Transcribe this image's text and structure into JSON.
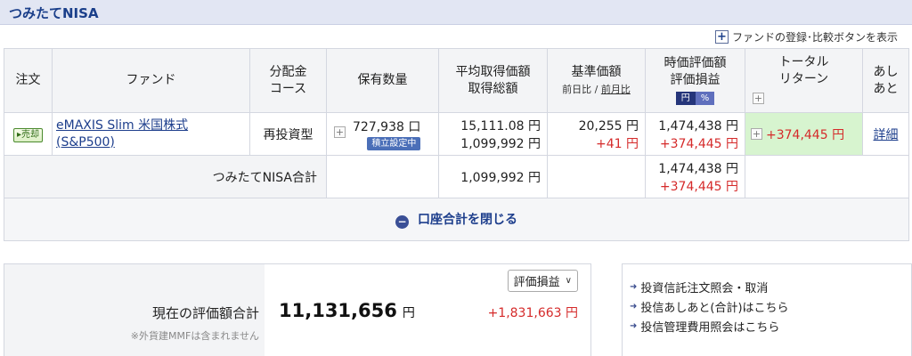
{
  "section": {
    "title": "つみたてNISA"
  },
  "toolbar": {
    "fund_register_label": "ファンドの登録･比較ボタンを表示"
  },
  "table": {
    "headers": {
      "order": "注文",
      "fund": "ファンド",
      "course_line1": "分配金",
      "course_line2": "コース",
      "quantity": "保有数量",
      "avg_line1": "平均取得価額",
      "avg_line2": "取得総額",
      "base_price": "基準価額",
      "base_prev_day": "前日比",
      "base_sep": " / ",
      "base_prev_month": "前月比",
      "market_line1": "時価評価額",
      "market_line2": "評価損益",
      "yen_btn": "円",
      "pct_btn": "%",
      "total_line1": "トータル",
      "total_line2": "リターン",
      "ashiato_line1": "あし",
      "ashiato_line2": "あと"
    },
    "row": {
      "order_badge": "売却",
      "fund_name_line1": "eMAXIS Slim 米国株式",
      "fund_name_line2": "(S&P500)",
      "course": "再投資型",
      "quantity": "727,938 口",
      "setting_badge": "積立設定中",
      "avg_price": "15,111.08 円",
      "total_cost": "1,099,992 円",
      "base_price": "20,255 円",
      "base_change": "+41 円",
      "market_value": "1,474,438 円",
      "market_gain": "+374,445 円",
      "total_return": "+374,445 円",
      "detail_link": "詳細"
    },
    "total_row": {
      "label": "つみたてNISA合計",
      "total_cost": "1,099,992 円",
      "market_value": "1,474,438 円",
      "market_gain": "+374,445 円"
    },
    "close_label": "口座合計を閉じる"
  },
  "summary": {
    "label": "現在の評価額合計",
    "note": "※外貨建MMFは含まれません",
    "value": "11,131,656",
    "unit": "円",
    "gain": "+1,831,663 円",
    "select_value": "評価損益"
  },
  "links": [
    "投資信託注文照会・取消",
    "投信あしあと(合計)はこちら",
    "投信管理費用照会はこちら"
  ],
  "colors": {
    "accent": "#1b3f8a",
    "positive": "#d52a2a",
    "return_bg": "#d7f4cf"
  }
}
